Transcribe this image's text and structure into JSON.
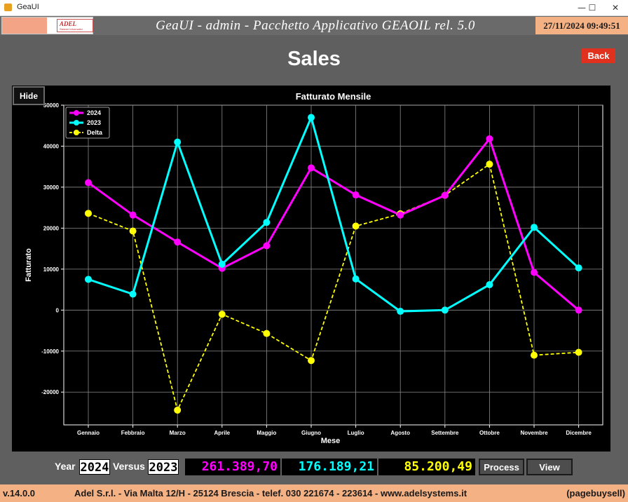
{
  "window": {
    "title": "GeaUI",
    "minimize": "—",
    "maximize": "☐",
    "close": "✕"
  },
  "header": {
    "logo_text": "ADEL",
    "logo_sub": "Sistemi Informatici",
    "title": "GeaUI - admin - Pacchetto Applicativo GEAOIL rel. 5.0",
    "clock": "27/11/2024 09:49:51"
  },
  "page": {
    "title": "Sales",
    "back_label": "Back",
    "hide_label": "Hide"
  },
  "chart_data": {
    "type": "line",
    "title": "Fatturato Mensile",
    "xlabel": "Mese",
    "ylabel": "Fatturato",
    "categories": [
      "Gennaio",
      "Febbraio",
      "Marzo",
      "Aprile",
      "Maggio",
      "Giugno",
      "Luglio",
      "Agosto",
      "Settembre",
      "Ottobre",
      "Novembre",
      "Dicembre"
    ],
    "yticks": [
      -20000,
      -10000,
      0,
      10000,
      20000,
      30000,
      40000,
      50000
    ],
    "ylim": [
      -28000,
      50000
    ],
    "grid": true,
    "legend_position": "top-left",
    "series": [
      {
        "name": "2024",
        "color": "#ff00ff",
        "dashed": false,
        "values": [
          31100,
          23200,
          16600,
          10200,
          15700,
          34700,
          28100,
          23200,
          28000,
          41800,
          9200,
          0
        ]
      },
      {
        "name": "2023",
        "color": "#00ffff",
        "dashed": false,
        "values": [
          7500,
          3900,
          41000,
          11200,
          21400,
          47000,
          7600,
          -300,
          0,
          6200,
          20200,
          10300
        ]
      },
      {
        "name": "Delta",
        "color": "#ffff00",
        "dashed": true,
        "values": [
          23600,
          19300,
          -24400,
          -1000,
          -5700,
          -12300,
          20500,
          23500,
          28000,
          35600,
          -11000,
          -10300
        ]
      }
    ]
  },
  "controls": {
    "year_label": "Year",
    "year_value": "2024",
    "versus_label": "Versus",
    "versus_value": "2023",
    "total_2024": "261.389,70",
    "total_2023": "176.189,21",
    "total_delta": "85.200,49",
    "process_label": "Process",
    "view_label": "View",
    "colors": {
      "total_2024": "#ff00ff",
      "total_2023": "#00ffff",
      "total_delta": "#ffff00"
    }
  },
  "footer": {
    "version": "v.14.0.0",
    "company": "Adel S.r.l. - Via Malta 12/H - 25124 Brescia - telef. 030 221674 - 223614 - www.adelsystems.it",
    "page_id": "(pagebuysell)"
  }
}
